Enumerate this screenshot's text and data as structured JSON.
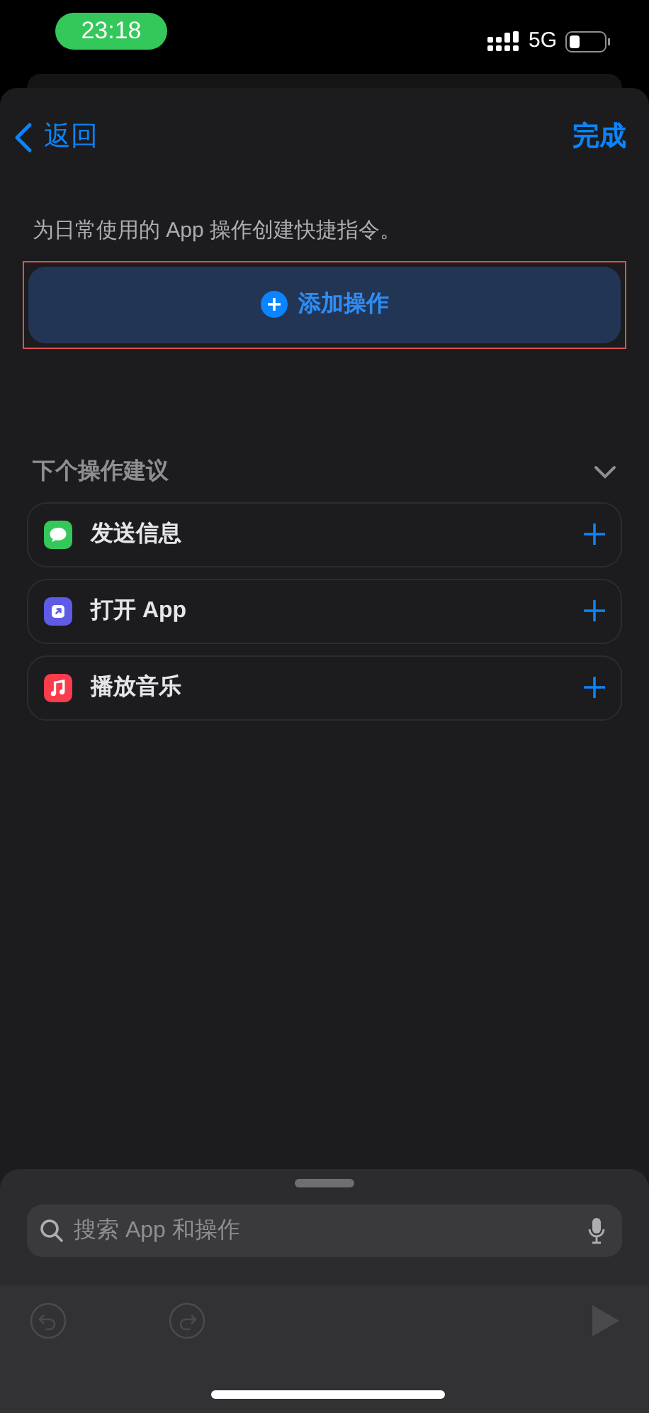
{
  "status_bar": {
    "time": "23:18",
    "network": "5G"
  },
  "nav": {
    "back": "返回",
    "done": "完成"
  },
  "description": "为日常使用的 App 操作创建快捷指令。",
  "add_action": {
    "label": "添加操作",
    "highlighted": true
  },
  "suggestions": {
    "title": "下个操作建议",
    "expanded": true,
    "items": [
      {
        "label": "发送信息",
        "kind": "message",
        "color": "#34c759"
      },
      {
        "label": "打开 App",
        "kind": "open-app",
        "color": "#5e5ce6"
      },
      {
        "label": "播放音乐",
        "kind": "music",
        "color": "#fa3c4c"
      }
    ]
  },
  "search": {
    "placeholder": "搜索 App 和操作"
  },
  "toolbar": {
    "undo_disabled": true,
    "redo_disabled": true,
    "play_disabled": true
  }
}
